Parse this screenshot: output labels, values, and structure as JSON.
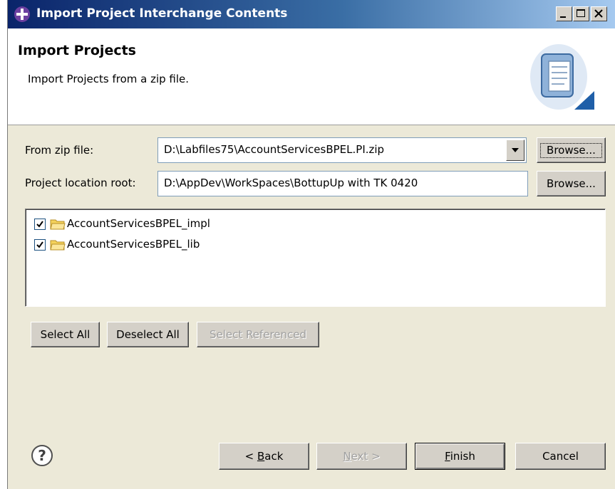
{
  "window": {
    "title": "Import Project Interchange Contents",
    "icon": "eclipse-app-icon",
    "controls": [
      "minimize-icon",
      "maximize-icon",
      "close-icon"
    ]
  },
  "header": {
    "title": "Import Projects",
    "description": "Import Projects from a zip file.",
    "graphic": "import-wizard-icon"
  },
  "form": {
    "zip_label": "From zip file:",
    "zip_value": "D:\\Labfiles75\\AccountServicesBPEL.PI.zip",
    "zip_browse": "Browse...",
    "root_label": "Project location root:",
    "root_value": "D:\\AppDev\\WorkSpaces\\BottupUp with TK 0420",
    "root_browse": "Browse..."
  },
  "projects": [
    {
      "label": "AccountServicesBPEL_impl",
      "checked": true
    },
    {
      "label": "AccountServicesBPEL_lib",
      "checked": true
    }
  ],
  "selection_buttons": {
    "select_all": "Select All",
    "deselect_all": "Deselect All",
    "select_referenced": "Select Referenced"
  },
  "footer": {
    "help_icon": "help-icon",
    "back_label": "Back",
    "back_prefix": "< ",
    "back_mnemonic": "B",
    "back_rest": "ack",
    "next_label": "Next >",
    "next_mnemonic": "N",
    "next_rest": "ext >",
    "finish_mnemonic": "F",
    "finish_rest": "inish",
    "cancel_label": "Cancel"
  },
  "colors": {
    "title_gradient_start": "#0a246a",
    "title_gradient_end": "#a6caf0",
    "dialog_bg": "#ece9d8",
    "disabled_text": "#a0a0a0"
  }
}
